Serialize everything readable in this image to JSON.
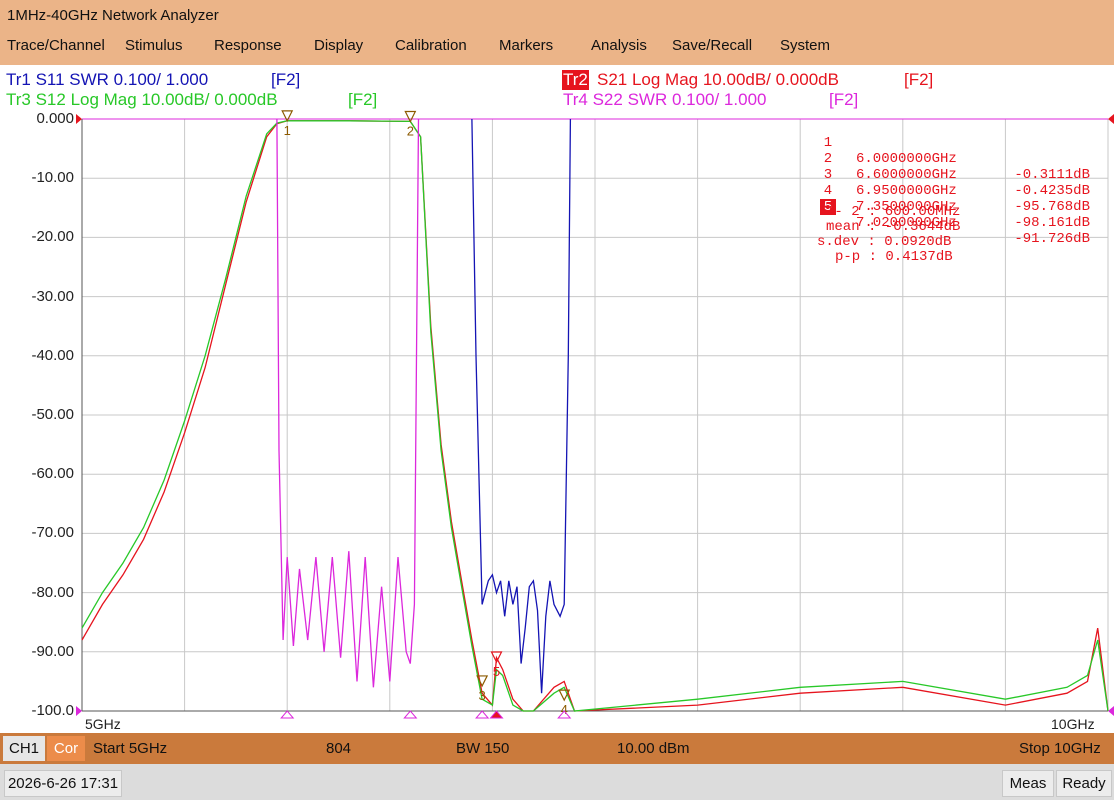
{
  "window": {
    "title": "1MHz-40GHz Network Analyzer"
  },
  "menu": [
    "Trace/Channel",
    "Stimulus",
    "Response",
    "Display",
    "Calibration",
    "Markers",
    "Analysis",
    "Save/Recall",
    "System"
  ],
  "traces": {
    "tr1": {
      "text": "Tr1 S11 SWR 0.100/ 1.000",
      "key": "[F2]",
      "color": "#1414b4"
    },
    "tr2": {
      "badge": "Tr2",
      "text": "S21 Log Mag 10.00dB/ 0.000dB",
      "key": "[F2]",
      "color": "#e6141e"
    },
    "tr3": {
      "text": "Tr3 S12 Log Mag 10.00dB/ 0.000dB",
      "key": "[F2]",
      "color": "#28c828"
    },
    "tr4": {
      "text": "Tr4 S22 SWR 0.100/ 1.000",
      "key": "[F2]",
      "color": "#dc28dc"
    }
  },
  "chart_data": {
    "type": "line",
    "x_start_label": "5GHz",
    "x_stop_label": "10GHz",
    "xlim": [
      5,
      10
    ],
    "ylim": [
      -100,
      0
    ],
    "y_ticks": [
      "0.000",
      "-10.00",
      "-20.00",
      "-30.00",
      "-40.00",
      "-50.00",
      "-60.00",
      "-70.00",
      "-80.00",
      "-90.00",
      "-100.0"
    ],
    "grid": true,
    "series": [
      {
        "name": "Tr2 S21",
        "color": "#e6141e",
        "x": [
          5.0,
          5.1,
          5.2,
          5.3,
          5.4,
          5.5,
          5.6,
          5.7,
          5.8,
          5.9,
          5.95,
          6.0,
          6.3,
          6.6,
          6.65,
          6.7,
          6.75,
          6.8,
          6.85,
          6.9,
          6.95,
          7.0,
          7.02,
          7.05,
          7.1,
          7.15,
          7.2,
          7.3,
          7.35,
          7.4,
          8.0,
          8.5,
          9.0,
          9.5,
          9.8,
          9.9,
          9.95,
          10.0
        ],
        "y": [
          -88,
          -82,
          -77,
          -71,
          -63,
          -53,
          -42,
          -28,
          -14,
          -3,
          -0.8,
          -0.3,
          -0.3,
          -0.4,
          -3,
          -35,
          -55,
          -68,
          -78,
          -88,
          -97,
          -99,
          -91,
          -93,
          -98,
          -100,
          -100,
          -96,
          -95,
          -100,
          -99,
          -97,
          -96,
          -99,
          -97,
          -95,
          -86,
          -100
        ]
      },
      {
        "name": "Tr3 S12",
        "color": "#28c828",
        "x": [
          5.0,
          5.1,
          5.2,
          5.3,
          5.4,
          5.5,
          5.6,
          5.7,
          5.8,
          5.9,
          5.95,
          6.0,
          6.3,
          6.6,
          6.65,
          6.7,
          6.75,
          6.8,
          6.85,
          6.9,
          6.95,
          7.0,
          7.02,
          7.05,
          7.1,
          7.15,
          7.2,
          7.3,
          7.35,
          7.4,
          8.0,
          8.5,
          9.0,
          9.5,
          9.8,
          9.9,
          9.95,
          10.0
        ],
        "y": [
          -86,
          -80,
          -75,
          -69,
          -61,
          -51,
          -40,
          -27,
          -13,
          -2.5,
          -0.7,
          -0.3,
          -0.3,
          -0.4,
          -3,
          -36,
          -56,
          -69,
          -79,
          -89,
          -98,
          -99,
          -93,
          -94,
          -99,
          -100,
          -100,
          -97,
          -96,
          -100,
          -98,
          -96,
          -95,
          -98,
          -96,
          -94,
          -88,
          -100
        ]
      },
      {
        "name": "Tr1 S11",
        "color": "#1414b4",
        "x": [
          6.9,
          6.92,
          6.95,
          6.98,
          7.0,
          7.02,
          7.04,
          7.06,
          7.08,
          7.1,
          7.12,
          7.14,
          7.16,
          7.18,
          7.2,
          7.22,
          7.24,
          7.26,
          7.28,
          7.3,
          7.33,
          7.35,
          7.37,
          7.38
        ],
        "y": [
          0,
          -40,
          -82,
          -78,
          -77,
          -80,
          -78,
          -84,
          -78,
          -82,
          -79,
          -92,
          -86,
          -79,
          -78,
          -83,
          -97,
          -84,
          -78,
          -82,
          -84,
          -82,
          -40,
          0
        ]
      },
      {
        "name": "Tr4 S22",
        "color": "#dc28dc",
        "x": [
          5.95,
          5.96,
          5.98,
          6.0,
          6.03,
          6.06,
          6.1,
          6.14,
          6.18,
          6.22,
          6.26,
          6.3,
          6.34,
          6.38,
          6.42,
          6.46,
          6.5,
          6.54,
          6.58,
          6.6,
          6.62,
          6.64
        ],
        "y": [
          0,
          -56,
          -88,
          -74,
          -89,
          -76,
          -88,
          -74,
          -90,
          -74,
          -91,
          -73,
          -95,
          -74,
          -96,
          -79,
          -95,
          -74,
          -90,
          -92,
          -82,
          0
        ]
      }
    ],
    "markers": [
      {
        "num": "1",
        "freq": "6.0000000GHz",
        "value": "-0.3111dB",
        "x": 6.0,
        "y": -0.3111
      },
      {
        "num": "2",
        "freq": "6.6000000GHz",
        "value": "-0.4235dB",
        "x": 6.6,
        "y": -0.4235
      },
      {
        "num": "3",
        "freq": "6.9500000GHz",
        "value": "-95.768dB",
        "x": 6.95,
        "y": -95.768
      },
      {
        "num": "4",
        "freq": "7.3500000GHz",
        "value": "-98.161dB",
        "x": 7.35,
        "y": -98.161
      },
      {
        "num": "5",
        "freq": "7.0200000GHz",
        "value": "-91.726dB",
        "x": 7.02,
        "y": -91.726,
        "active": true
      }
    ],
    "marker_stats": {
      "span": "1- 2 : 600.00MHz",
      "mean": "mean : -0.3644dB",
      "sdev": "s.dev : 0.0920dB",
      "pp": "p-p : 0.4137dB"
    }
  },
  "status": {
    "channel": "CH1",
    "cor": "Cor",
    "start": "Start 5GHz",
    "points": "804",
    "bw": "BW 150",
    "power": "10.00 dBm",
    "stop": "Stop 10GHz",
    "datetime": "2026-6-26 17:31",
    "meas": "Meas",
    "ready": "Ready"
  }
}
